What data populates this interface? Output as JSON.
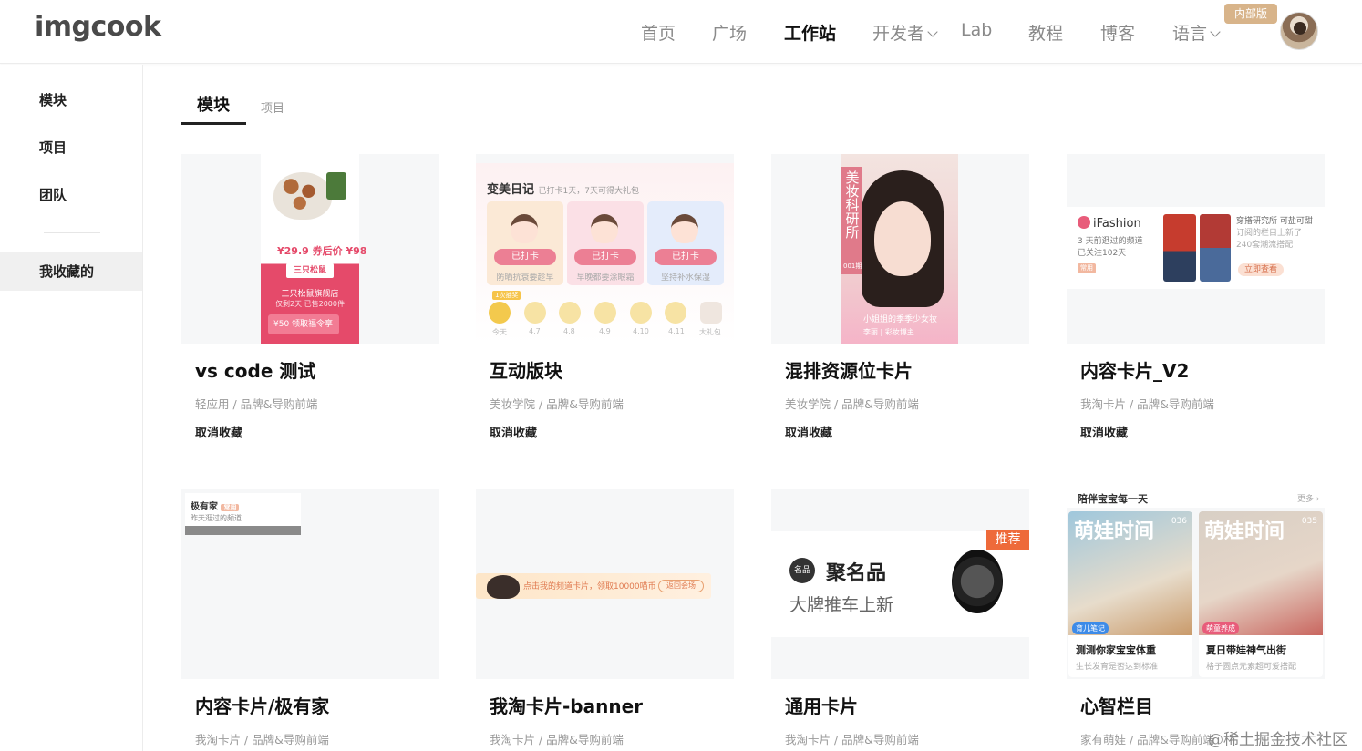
{
  "header": {
    "logo": "imgcook",
    "nav": [
      {
        "label": "首页",
        "has_dropdown": false
      },
      {
        "label": "广场",
        "has_dropdown": false
      },
      {
        "label": "工作站",
        "has_dropdown": false,
        "active": true
      },
      {
        "label": "开发者",
        "has_dropdown": true
      },
      {
        "label": "Lab",
        "has_dropdown": false
      },
      {
        "label": "教程",
        "has_dropdown": false
      },
      {
        "label": "博客",
        "has_dropdown": false
      },
      {
        "label": "语言",
        "has_dropdown": true
      }
    ],
    "badge": "内部版"
  },
  "sidebar": {
    "items": [
      {
        "label": "模块"
      },
      {
        "label": "项目"
      },
      {
        "label": "团队"
      },
      {
        "label": "我收藏的",
        "active": true
      }
    ]
  },
  "tabs": [
    {
      "label": "模块",
      "active": true
    },
    {
      "label": "项目",
      "active": false
    }
  ],
  "cards": [
    {
      "title": "vs code 测试",
      "meta": "轻应用 / 品牌&导购前端",
      "action": "取消收藏",
      "thumb": {
        "price": "¥29.9 券后价 ¥98",
        "brand": "三只松鼠",
        "shop": "三只松鼠旗舰店",
        "shop_sub": "仅剩2天 已售2000件",
        "coupon": "¥50 领取福令享"
      }
    },
    {
      "title": "互动版块",
      "meta": "美妆学院 / 品牌&导购前端",
      "action": "取消收藏",
      "thumb": {
        "title": "变美日记",
        "sub": "已打卡1天，7天可得大礼包",
        "panels": [
          {
            "btn": "已打卡",
            "cap": "防晒抗衰要趁早"
          },
          {
            "btn": "已打卡",
            "cap": "早晚都要涂眼霜"
          },
          {
            "btn": "已打卡",
            "cap": "坚持补水保湿"
          }
        ],
        "days": [
          "今天",
          "4.7",
          "4.8",
          "4.9",
          "4.10",
          "4.11",
          "大礼包"
        ],
        "first_tag": "1次抽奖"
      }
    },
    {
      "title": "混排资源位卡片",
      "meta": "美妆学院 / 品牌&导购前端",
      "action": "取消收藏",
      "thumb": {
        "vertical": "美妆科研所",
        "num": "001期",
        "caption": "小姐姐的季季少女妆",
        "user": "李丽 | 彩妆博主"
      }
    },
    {
      "title": "内容卡片_V2",
      "meta": "我淘卡片 / 品牌&导购前端",
      "action": "取消收藏",
      "thumb": {
        "brand": "iFashion",
        "sub1": "3 天前逛过的频道",
        "sub2": "已关注102天",
        "tag": "常用",
        "right1": "穿搭研究所  可盐可甜",
        "right2": "订阅的栏目上新了",
        "right3": "240套潮流搭配",
        "btn": "立即查看"
      }
    },
    {
      "title": "内容卡片/极有家",
      "meta": "我淘卡片 / 品牌&导购前端",
      "action": "",
      "thumb": {
        "title": "极有家",
        "tag": "常用",
        "sub": "昨天逛过的频道"
      }
    },
    {
      "title": "我淘卡片-banner",
      "meta": "我淘卡片 / 品牌&导购前端",
      "action": "",
      "thumb": {
        "text": "点击我的频道卡片，领取10000喵币",
        "btn": "返回会场"
      }
    },
    {
      "title": "通用卡片",
      "meta": "我淘卡片 / 品牌&导购前端",
      "action": "",
      "thumb": {
        "flag": "推荐",
        "logo": "名品",
        "name": "聚名品",
        "slogan": "大牌推车上新"
      }
    },
    {
      "title": "心智栏目",
      "meta": "家有萌娃 / 品牌&导购前端",
      "action": "",
      "thumb": {
        "title": "陪伴宝宝每一天",
        "more": "更多 ›",
        "items": [
          {
            "brand": "萌娃时间",
            "num": "036",
            "pill": "育儿笔记",
            "cap": "测测你家宝宝体重",
            "sub": "生长发育是否达到标准"
          },
          {
            "brand": "萌娃时间",
            "num": "035",
            "pill": "萌童养成",
            "cap": "夏日带娃神气出街",
            "sub": "格子圆点元素超可爱搭配"
          }
        ]
      }
    }
  ],
  "watermark": "@稀土掘金技术社区",
  "colors": {
    "accent": "#222222",
    "muted": "#9a9a9a",
    "badge": "#d8b48a",
    "brand_pink": "#e54a6a"
  }
}
